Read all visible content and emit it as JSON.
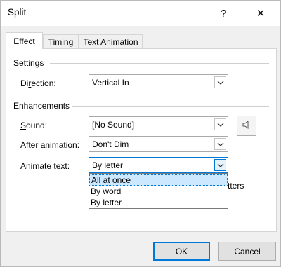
{
  "window": {
    "title": "Split",
    "help_glyph": "?",
    "close_glyph": "✕"
  },
  "tabs": [
    {
      "label": "Effect",
      "active": true
    },
    {
      "label": "Timing",
      "active": false
    },
    {
      "label": "Text Animation",
      "active": false
    }
  ],
  "settings": {
    "group_label": "Settings",
    "direction": {
      "label_pre": "Di",
      "label_ul": "r",
      "label_post": "ection:",
      "value": "Vertical In"
    }
  },
  "enhancements": {
    "group_label": "Enhancements",
    "sound": {
      "label_pre": "",
      "label_ul": "S",
      "label_post": "ound:",
      "value": "[No Sound]"
    },
    "after_animation": {
      "label_pre": "",
      "label_ul": "A",
      "label_post": "fter animation:",
      "value": "Don't Dim"
    },
    "animate_text": {
      "label_pre": "Animate te",
      "label_ul": "x",
      "label_post": "t:",
      "value": "By letter"
    },
    "dropdown_options": [
      {
        "label": "All at once",
        "selected": true
      },
      {
        "label": "By word",
        "selected": false
      },
      {
        "label": "By letter",
        "selected": false
      }
    ],
    "hidden_partial_text": "tters"
  },
  "buttons": {
    "ok": "OK",
    "cancel": "Cancel"
  },
  "colors": {
    "accent": "#0078d7",
    "selection": "#cce8ff"
  }
}
